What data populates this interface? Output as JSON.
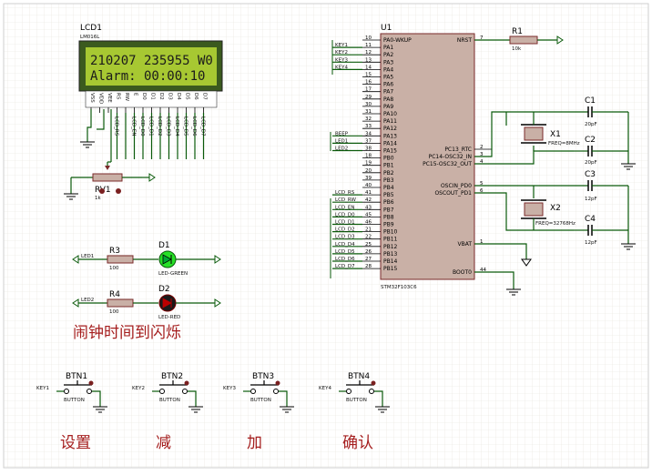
{
  "lcd": {
    "ref": "LCD1",
    "model": "LM016L",
    "line1": "210207 235955 W0",
    "line2": "Alarm: 00:00:10",
    "pins": [
      "VSS",
      "VDD",
      "VEE",
      "RS",
      "RW",
      "E",
      "D0",
      "D1",
      "D2",
      "D3",
      "D4",
      "D5",
      "D6",
      "D7"
    ],
    "nets": [
      "LCD_RS",
      "",
      "LCD_EN",
      "LCD_D0",
      "LCD_D1",
      "LCD_D2",
      "LCD_D3",
      "LCD_D4",
      "LCD_D5",
      "LCD_D6",
      "LCD_D7"
    ]
  },
  "rv1": {
    "ref": "RV1",
    "value": "1k"
  },
  "mcu": {
    "ref": "U1",
    "model": "STM32F103C6",
    "left_pins": [
      {
        "num": "10",
        "name": "PA0-WKUP",
        "net": ""
      },
      {
        "num": "11",
        "name": "PA1",
        "net": "KEY1"
      },
      {
        "num": "12",
        "name": "PA2",
        "net": "KEY2"
      },
      {
        "num": "13",
        "name": "PA3",
        "net": "KEY3"
      },
      {
        "num": "14",
        "name": "PA4",
        "net": "KEY4"
      },
      {
        "num": "15",
        "name": "PA5",
        "net": ""
      },
      {
        "num": "16",
        "name": "PA6",
        "net": ""
      },
      {
        "num": "17",
        "name": "PA7",
        "net": ""
      },
      {
        "num": "29",
        "name": "PA8",
        "net": ""
      },
      {
        "num": "30",
        "name": "PA9",
        "net": ""
      },
      {
        "num": "31",
        "name": "PA10",
        "net": ""
      },
      {
        "num": "32",
        "name": "PA11",
        "net": ""
      },
      {
        "num": "33",
        "name": "PA12",
        "net": ""
      },
      {
        "num": "34",
        "name": "PA13",
        "net": "BEEP"
      },
      {
        "num": "37",
        "name": "PA14",
        "net": "LED1"
      },
      {
        "num": "38",
        "name": "PA15",
        "net": "LED2"
      },
      {
        "num": "18",
        "name": "PB0",
        "net": ""
      },
      {
        "num": "19",
        "name": "PB1",
        "net": ""
      },
      {
        "num": "20",
        "name": "PB2",
        "net": ""
      },
      {
        "num": "39",
        "name": "PB3",
        "net": ""
      },
      {
        "num": "40",
        "name": "PB4",
        "net": ""
      },
      {
        "num": "41",
        "name": "PB5",
        "net": "LCD_RS"
      },
      {
        "num": "42",
        "name": "PB6",
        "net": "LCD_RW"
      },
      {
        "num": "43",
        "name": "PB7",
        "net": "LCD_EN"
      },
      {
        "num": "45",
        "name": "PB8",
        "net": "LCD_D0"
      },
      {
        "num": "46",
        "name": "PB9",
        "net": "LCD_D1"
      },
      {
        "num": "21",
        "name": "PB10",
        "net": "LCD_D2"
      },
      {
        "num": "22",
        "name": "PB11",
        "net": "LCD_D3"
      },
      {
        "num": "25",
        "name": "PB12",
        "net": "LCD_D4"
      },
      {
        "num": "26",
        "name": "PB13",
        "net": "LCD_D5"
      },
      {
        "num": "27",
        "name": "PB14",
        "net": "LCD_D6"
      },
      {
        "num": "28",
        "name": "PB15",
        "net": "LCD_D7"
      }
    ],
    "right_pins": [
      {
        "num": "7",
        "name": "NRST"
      },
      {
        "num": "2",
        "name": "PC13_RTC"
      },
      {
        "num": "3",
        "name": "PC14-OSC32_IN"
      },
      {
        "num": "4",
        "name": "PC15-OSC32_OUT"
      },
      {
        "num": "5",
        "name": "OSCIN_PD0"
      },
      {
        "num": "6",
        "name": "OSCOUT_PD1"
      },
      {
        "num": "1",
        "name": "VBAT"
      },
      {
        "num": "44",
        "name": "BOOT0"
      }
    ]
  },
  "r1": {
    "ref": "R1",
    "value": "10k"
  },
  "c1": {
    "ref": "C1",
    "value": "20pF"
  },
  "c2": {
    "ref": "C2",
    "value": "20pF"
  },
  "c3": {
    "ref": "C3",
    "value": "12pF"
  },
  "c4": {
    "ref": "C4",
    "value": "12pF"
  },
  "x1": {
    "ref": "X1",
    "freq": "FREQ=8MHz"
  },
  "x2": {
    "ref": "X2",
    "freq": "FREQ=32768Hz"
  },
  "r3": {
    "ref": "R3",
    "value": "100",
    "net": "LED1"
  },
  "r4": {
    "ref": "R4",
    "value": "100",
    "net": "LED2"
  },
  "d1": {
    "ref": "D1",
    "model": "LED-GREEN",
    "color": "#27e027"
  },
  "d2": {
    "ref": "D2",
    "model": "LED-RED",
    "color": "#1a1a1a"
  },
  "alarm_caption": "闹钟时间到闪烁",
  "buttons": [
    {
      "ref": "BTN1",
      "model": "BUTTON",
      "net": "KEY1",
      "caption": "设置"
    },
    {
      "ref": "BTN2",
      "model": "BUTTON",
      "net": "KEY2",
      "caption": "减"
    },
    {
      "ref": "BTN3",
      "model": "BUTTON",
      "net": "KEY3",
      "caption": "加"
    },
    {
      "ref": "BTN4",
      "model": "BUTTON",
      "net": "KEY4",
      "caption": "确认"
    }
  ],
  "colors": {
    "wire": "#0a5a0a",
    "caption": "#a51e1e",
    "lcd_bg": "#a7c832",
    "body": "#c9b0a6"
  }
}
